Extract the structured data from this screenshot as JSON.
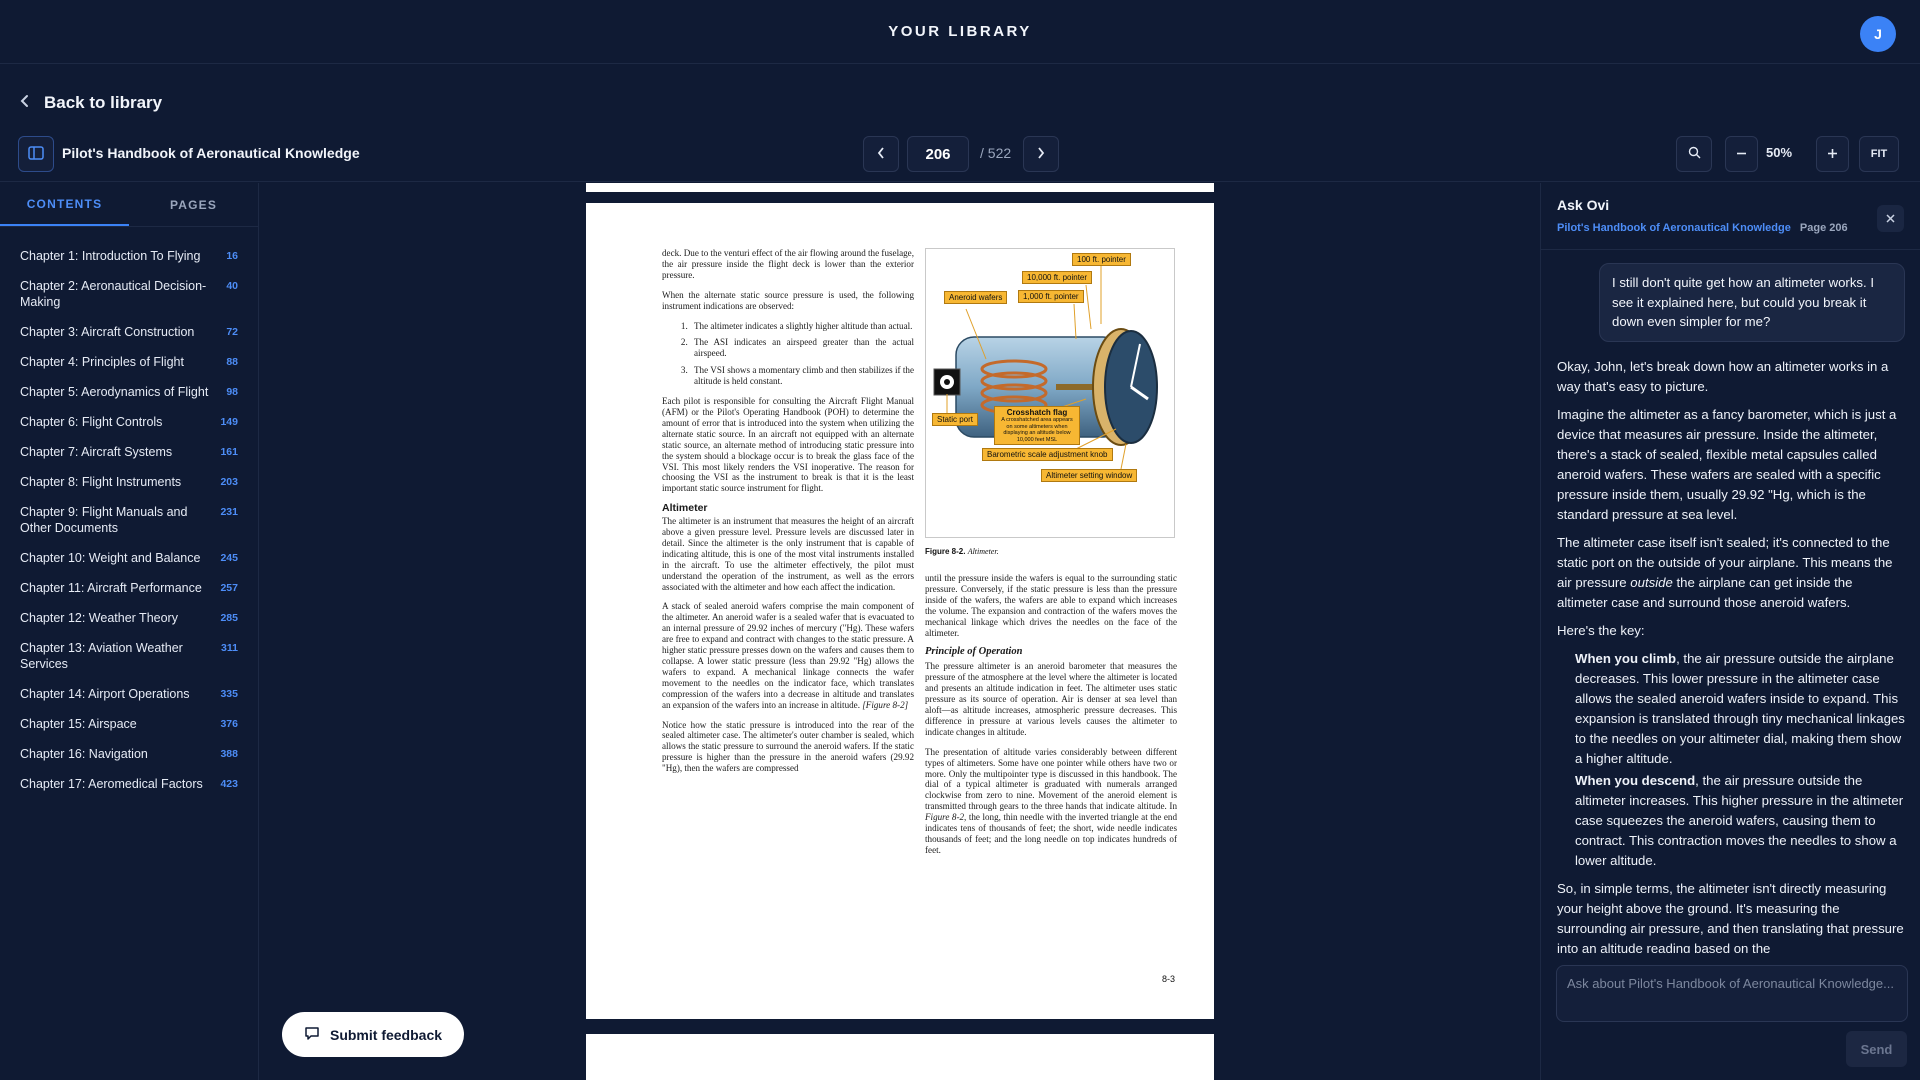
{
  "header": {
    "title": "YOUR LIBRARY",
    "avatar_initial": "J"
  },
  "nav": {
    "back_label": "Back to library"
  },
  "toolbar": {
    "book_title": "Pilot's Handbook of Aeronautical Knowledge",
    "page_current": "206",
    "page_total": "/ 522",
    "zoom": "50%",
    "fit_label": "FIT"
  },
  "sidebar": {
    "tabs": [
      "CONTENTS",
      "PAGES"
    ],
    "active_tab": "CONTENTS",
    "chapters": [
      {
        "title": "Chapter 1: Introduction To Flying",
        "page": "16"
      },
      {
        "title": "Chapter 2: Aeronautical Decision-Making",
        "page": "40"
      },
      {
        "title": "Chapter 3: Aircraft Construction",
        "page": "72"
      },
      {
        "title": "Chapter 4: Principles of Flight",
        "page": "88"
      },
      {
        "title": "Chapter 5: Aerodynamics of Flight",
        "page": "98"
      },
      {
        "title": "Chapter 6: Flight Controls",
        "page": "149"
      },
      {
        "title": "Chapter 7: Aircraft Systems",
        "page": "161"
      },
      {
        "title": "Chapter 8: Flight Instruments",
        "page": "203"
      },
      {
        "title": "Chapter 9: Flight Manuals and Other Documents",
        "page": "231"
      },
      {
        "title": "Chapter 10: Weight and Balance",
        "page": "245"
      },
      {
        "title": "Chapter 11: Aircraft Performance",
        "page": "257"
      },
      {
        "title": "Chapter 12: Weather Theory",
        "page": "285"
      },
      {
        "title": "Chapter 13: Aviation Weather Services",
        "page": "311"
      },
      {
        "title": "Chapter 14: Airport Operations",
        "page": "335"
      },
      {
        "title": "Chapter 15: Airspace",
        "page": "376"
      },
      {
        "title": "Chapter 16: Navigation",
        "page": "388"
      },
      {
        "title": "Chapter 17: Aeromedical Factors",
        "page": "423"
      }
    ]
  },
  "document": {
    "left_col": {
      "p1": "deck. Due to the venturi effect of the air flowing around the fuselage, the air pressure inside the flight deck is lower than the exterior pressure.",
      "p2": "When the alternate static source pressure is used, the following instrument indications are observed:",
      "list": [
        "The altimeter indicates a slightly higher altitude than actual.",
        "The ASI indicates an airspeed greater than the actual airspeed.",
        "The VSI shows a momentary climb and then stabilizes if the altitude is held constant."
      ],
      "p3": "Each pilot is responsible for consulting the Aircraft Flight Manual (AFM) or the Pilot's Operating Handbook (POH) to determine the amount of error that is introduced into the system when utilizing the alternate static source. In an aircraft not equipped with an alternate static source, an alternate method of introducing static pressure into the system should a blockage occur is to break the glass face of the VSI. This most likely renders the VSI inoperative. The reason for choosing the VSI as the instrument to break is that it is the least important static source instrument for flight.",
      "heading": "Altimeter",
      "p4": "The altimeter is an instrument that measures the height of an aircraft above a given pressure level. Pressure levels are discussed later in detail. Since the altimeter is the only instrument that is capable of indicating altitude, this is one of the most vital instruments installed in the aircraft. To use the altimeter effectively, the pilot must understand the operation of the instrument, as well as the errors associated with the altimeter and how each affect the indication.",
      "p5": "A stack of sealed aneroid wafers comprise the main component of the altimeter. An aneroid wafer is a sealed wafer that is evacuated to an internal pressure of 29.92 inches of mercury (\"Hg). These wafers are free to expand and contract with changes to the static pressure. A higher static pressure presses down on the wafers and causes them to collapse. A lower static pressure (less than 29.92 \"Hg) allows the wafers to expand. A mechanical linkage connects the wafer movement to the needles on the indicator face, which translates compression of the wafers into a decrease in altitude and translates an expansion of the wafers into an increase in altitude.",
      "p5_ref": "[Figure 8-2]",
      "p6": "Notice how the static pressure is introduced into the rear of the sealed altimeter case. The altimeter's outer chamber is sealed, which allows the static pressure to surround the aneroid wafers. If the static pressure is higher than the pressure in the aneroid wafers (29.92 \"Hg), then the wafers are compressed"
    },
    "right_col": {
      "p1": "until the pressure inside the wafers is equal to the surrounding static pressure. Conversely, if the static pressure is less than the pressure inside of the wafers, the wafers are able to expand which increases the volume. The expansion and contraction of the wafers moves the mechanical linkage which drives the needles on the face of the altimeter.",
      "heading": "Principle of Operation",
      "p2": "The pressure altimeter is an aneroid barometer that measures the pressure of the atmosphere at the level where the altimeter is located and presents an altitude indication in feet. The altimeter uses static pressure as its source of operation. Air is denser at sea level than aloft—as altitude increases, atmospheric pressure decreases. This difference in pressure at various levels causes the altimeter to indicate changes in altitude.",
      "p3a": "The presentation of altitude varies considerably between different types of altimeters. Some have one pointer while others have two or more. Only the multipointer type is discussed in this handbook. The dial of a typical altimeter is graduated with numerals arranged clockwise from zero to nine. Movement of the aneroid element is transmitted through gears to the three hands that indicate altitude. In",
      "p3_ref": "Figure 8-2",
      "p3b": ", the long, thin needle with the inverted triangle at the end indicates tens of thousands of feet; the short, wide needle indicates thousands of feet; and the long needle on top indicates hundreds of feet."
    },
    "figure": {
      "caption_num": "Figure 8-2.",
      "caption_text": "Altimeter.",
      "callouts": {
        "c100": "100 ft. pointer",
        "c10000": "10,000 ft. pointer",
        "c1000": "1,000 ft. pointer",
        "aneroid": "Aneroid wafers",
        "static": "Static port",
        "crosshatch": "Crosshatch flag",
        "crosshatch_note": "A crosshatched area appears on some altimeters when displaying an altitude below 10,000 feet MSL",
        "knob": "Barometric scale adjustment knob",
        "window": "Altimeter setting window"
      }
    },
    "page_number": "8-3"
  },
  "feedback": {
    "label": "Submit feedback"
  },
  "chat": {
    "title": "Ask Ovi",
    "book": "Pilot's Handbook of Aeronautical Knowledge",
    "page": "Page 206",
    "user_message": "I still don't quite get how an altimeter works. I see it explained here, but could you break it down even simpler for me?",
    "ai": {
      "p1": "Okay, John, let's break down how an altimeter works in a way that's easy to picture.",
      "p2": "Imagine the altimeter as a fancy barometer, which is just a device that measures air pressure. Inside the altimeter, there's a stack of sealed, flexible metal capsules called aneroid wafers. These wafers are sealed with a specific pressure inside them, usually 29.92 \"Hg, which is the standard pressure at sea level.",
      "p3a": "The altimeter case itself isn't sealed; it's connected to the static port on the outside of your airplane. This means the air pressure ",
      "p3em": "outside",
      "p3b": " the airplane can get inside the altimeter case and surround those aneroid wafers.",
      "p4": "Here's the key:",
      "climb_b": "When you climb",
      "climb_t": ", the air pressure outside the airplane decreases. This lower pressure in the altimeter case allows the sealed aneroid wafers inside to expand. This expansion is translated through tiny mechanical linkages to the needles on your altimeter dial, making them show a higher altitude.",
      "descend_b": "When you descend",
      "descend_t": ", the air pressure outside the altimeter increases. This higher pressure in the altimeter case squeezes the aneroid wafers, causing them to contract. This contraction moves the needles to show a lower altitude.",
      "p5": "So, in simple terms, the altimeter isn't directly measuring your height above the ground. It's measuring the surrounding air pressure, and then translating that pressure into an altitude reading based on the"
    },
    "input_placeholder": "Ask about Pilot's Handbook of Aeronautical Knowledge...",
    "send_label": "Send"
  }
}
